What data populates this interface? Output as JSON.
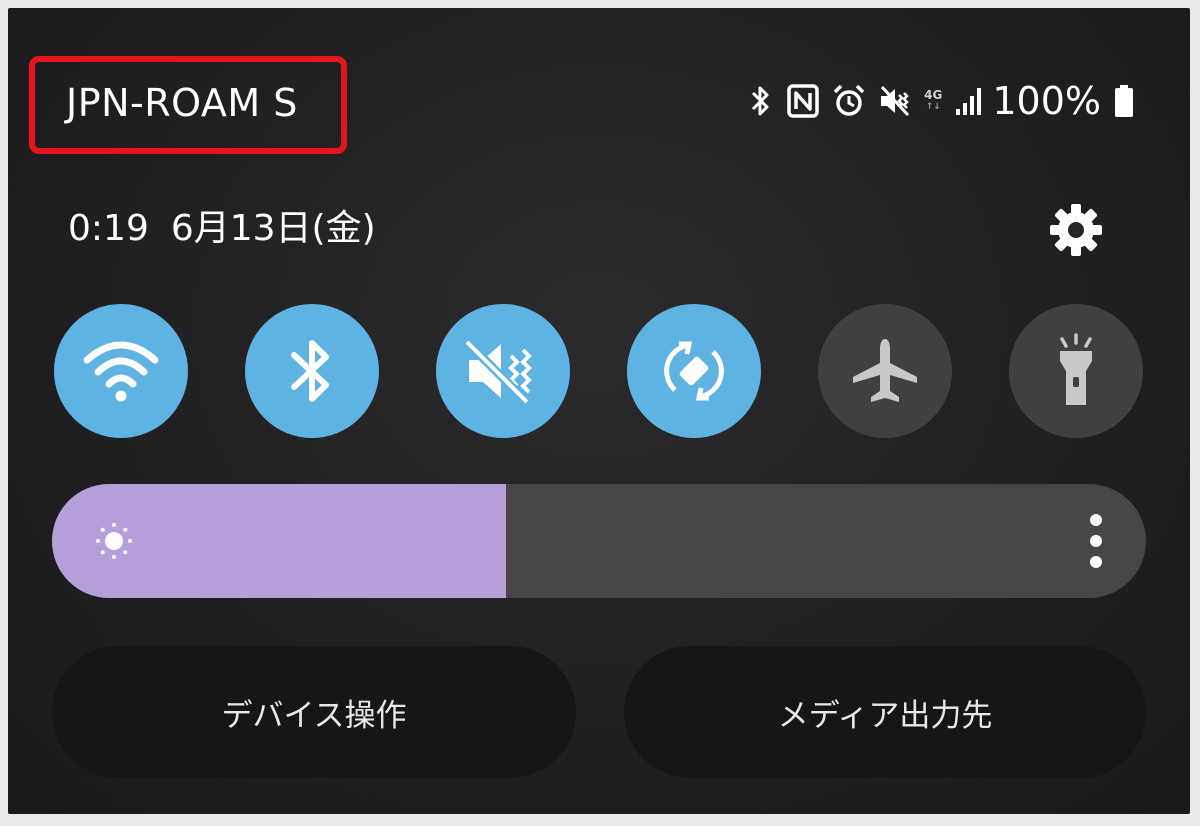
{
  "status_bar": {
    "carrier": "JPN-ROAM S",
    "network": "4G",
    "battery": "100%",
    "icons": [
      "bluetooth-icon",
      "nfc-icon",
      "alarm-icon",
      "mute-icon",
      "network-4g-icon",
      "signal-icon",
      "battery-icon"
    ]
  },
  "header": {
    "time": "0:19",
    "date": "6月13日(金)",
    "settings_icon": "gear-icon"
  },
  "quick_tiles": [
    {
      "name": "wifi",
      "icon": "wifi-icon",
      "active": true,
      "color": "#5fb3e2"
    },
    {
      "name": "bluetooth",
      "icon": "bluetooth-icon",
      "active": true,
      "color": "#5fb3e2"
    },
    {
      "name": "mute",
      "icon": "mute-vibrate-icon",
      "active": true,
      "color": "#5fb3e2"
    },
    {
      "name": "auto-rotate",
      "icon": "rotate-icon",
      "active": true,
      "color": "#5fb3e2"
    },
    {
      "name": "airplane",
      "icon": "airplane-icon",
      "active": false,
      "color": "#404042"
    },
    {
      "name": "flashlight",
      "icon": "flashlight-icon",
      "active": false,
      "color": "#404042"
    }
  ],
  "brightness": {
    "level": 0.415,
    "fill_color": "#b69fd8",
    "icon": "sun-icon",
    "menu_icon": "more-vert-icon"
  },
  "buttons": {
    "device_control": "デバイス操作",
    "media_output": "メディア出力先"
  },
  "colors": {
    "highlight_box": "#e8141c",
    "active_tile": "#5fb3e2",
    "inactive_tile": "#404042"
  }
}
